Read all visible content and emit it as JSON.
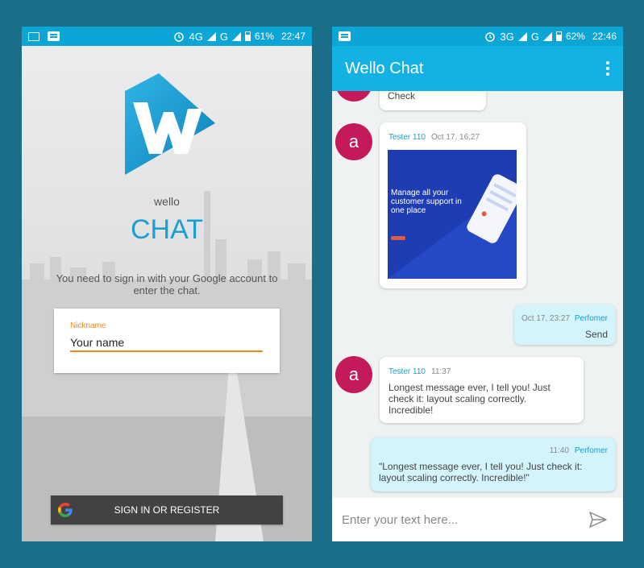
{
  "left": {
    "status": {
      "network": "4G",
      "network2": "G",
      "battery": "61%",
      "time": "22:47"
    },
    "app_name_small": "wello",
    "app_name_big": "CHAT",
    "signin_text": "You need to sign in with your Google account to enter the chat.",
    "nickname_label": "Nickname",
    "nickname_value": "Your name",
    "signin_button": "SIGN IN OR REGISTER"
  },
  "right": {
    "status": {
      "network": "3G",
      "network2": "G",
      "battery": "62%",
      "time": "22:46"
    },
    "title": "Wello Chat",
    "messages": [
      {
        "text": "Check"
      },
      {
        "avatar": "a",
        "author": "Tester 110",
        "time": "Oct 17, 16:27",
        "image": {
          "headline": "Manage all your customer support in one place"
        }
      },
      {
        "time": "Oct 17, 23:27",
        "author": "Perfomer",
        "text": "Send"
      },
      {
        "avatar": "a",
        "author": "Tester 110",
        "time": "11:37",
        "text": "Longest message ever, I tell you! Just check it: layout scaling correctly. Incredible!"
      },
      {
        "time": "11:40",
        "author": "Perfomer",
        "text": "\"Longest message ever, I tell you! Just check it: layout scaling correctly. Incredible!\""
      }
    ],
    "input_placeholder": "Enter your text here..."
  },
  "colors": {
    "accent": "#14b2e4",
    "avatar": "#c4195a",
    "nickname": "#e8891e",
    "bubble_me": "#d3f4fb"
  }
}
